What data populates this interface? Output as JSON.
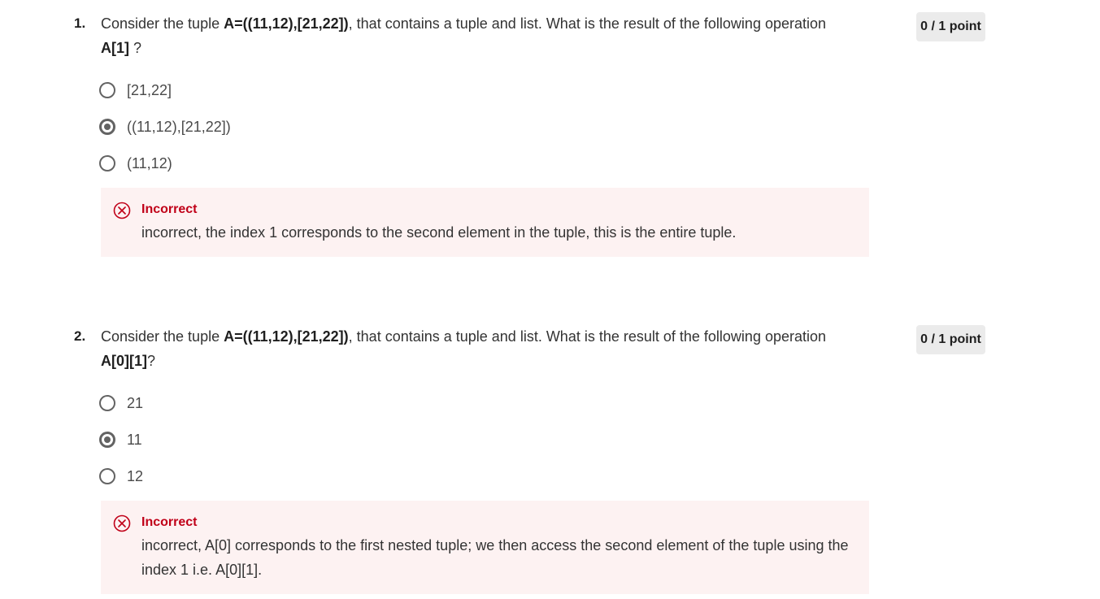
{
  "questions": [
    {
      "number": "1.",
      "text_pre": "Consider the tuple ",
      "text_bold": "A=((11,12),[21,22])",
      "text_post": ", that contains a tuple and list. What is the result of the following operation ",
      "operation": "A[1]",
      "operation_suffix": " ?",
      "points": "0 / 1 point",
      "options": [
        {
          "label": "[21,22]",
          "selected": false
        },
        {
          "label": "((11,12),[21,22])",
          "selected": true
        },
        {
          "label": "(11,12)",
          "selected": false
        }
      ],
      "feedback": {
        "icon": "close-circle-icon",
        "status": "Incorrect",
        "text": "incorrect, the index 1 corresponds to the second element in the tuple, this is the entire tuple."
      }
    },
    {
      "number": "2.",
      "text_pre": "Consider the tuple ",
      "text_bold": "A=((11,12),[21,22])",
      "text_post": ", that contains a tuple and list. What is the result of the following operation ",
      "operation": "A[0][1]",
      "operation_suffix": "?",
      "points": "0 / 1 point",
      "options": [
        {
          "label": "21",
          "selected": false
        },
        {
          "label": "11",
          "selected": true
        },
        {
          "label": "12",
          "selected": false
        }
      ],
      "feedback": {
        "icon": "close-circle-icon",
        "status": "Incorrect",
        "text": "incorrect, A[0] corresponds to the first nested tuple; we then access the second element of the tuple using the index 1 i.e. A[0][1]."
      }
    }
  ],
  "colors": {
    "incorrect": "#c00018",
    "feedback_bg": "#fdf2f2",
    "badge_bg": "#ebebeb",
    "radio": "#636363"
  }
}
